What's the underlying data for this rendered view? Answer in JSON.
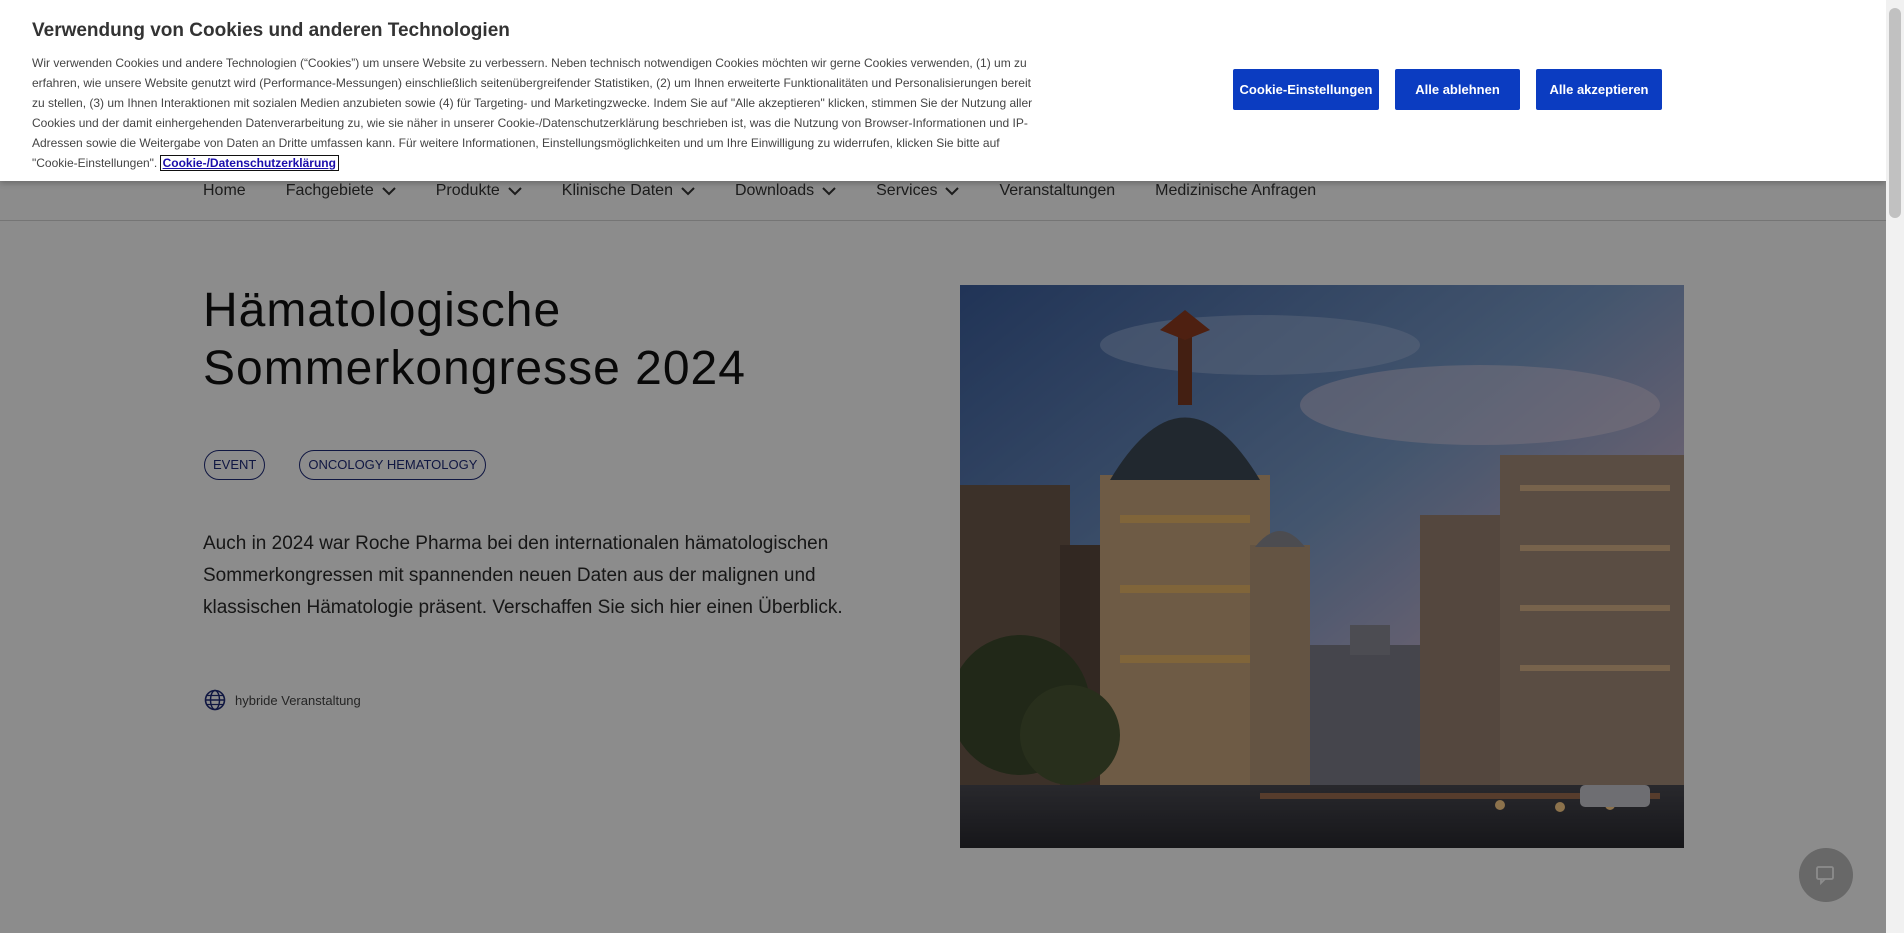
{
  "cookie_banner": {
    "title": "Verwendung von Cookies und anderen Technologien",
    "text": "Wir verwenden Cookies und andere Technologien (“Cookies”) um unsere Website zu verbessern. Neben technisch notwendigen Cookies möchten wir gerne Cookies verwenden, (1) um zu erfahren, wie unsere Website genutzt wird (Performance-Messungen) einschließlich seitenübergreifender Statistiken, (2) um Ihnen erweiterte Funktionalitäten und Personalisierungen bereit zu stellen, (3) um Ihnen Interaktionen mit sozialen Medien anzubieten sowie (4) für Targeting- und Marketingzwecke. Indem Sie auf \"Alle akzeptieren\" klicken, stimmen Sie der Nutzung aller Cookies und der damit einhergehenden Datenverarbeitung zu, wie sie näher in unserer Cookie-/Datenschutzerklärung beschrieben ist, was die Nutzung von Browser-Informationen und IP-Adressen sowie die Weitergabe von Daten an Dritte umfassen kann. Für weitere Informationen, Einstellungsmöglichkeiten und um Ihre Einwilligung zu widerrufen, klicken Sie bitte auf \"Cookie-Einstellungen\". ",
    "link_label": "Cookie-/Datenschutzerklärung",
    "settings_button": "Cookie-Einstellungen",
    "reject_button": "Alle ablehnen",
    "accept_button": "Alle akzeptieren"
  },
  "nav": {
    "items": [
      {
        "label": "Home",
        "has_dropdown": false
      },
      {
        "label": "Fachgebiete",
        "has_dropdown": true
      },
      {
        "label": "Produkte",
        "has_dropdown": true
      },
      {
        "label": "Klinische Daten",
        "has_dropdown": true
      },
      {
        "label": "Downloads",
        "has_dropdown": true
      },
      {
        "label": "Services",
        "has_dropdown": true
      },
      {
        "label": "Veranstaltungen",
        "has_dropdown": false
      },
      {
        "label": "Medizinische Anfragen",
        "has_dropdown": false
      }
    ]
  },
  "hero": {
    "title_line1": "Hämatologische",
    "title_line2": "Sommerkongresse 2024",
    "tags": [
      "EVENT",
      "ONCOLOGY HEMATOLOGY"
    ],
    "description": "Auch in 2024 war Roche Pharma bei den internationalen hämatologischen Sommerkongressen mit spannenden neuen Daten aus der malignen und klassischen Hämatologie präsent. Verschaffen Sie sich hier einen Überblick.",
    "format_icon": "globe-icon",
    "format_label": "hybride Veranstaltung"
  },
  "colors": {
    "accent": "#0b3cc1",
    "tag_border": "#1e2a78",
    "overlay": "rgba(0,0,0,0.45)"
  }
}
